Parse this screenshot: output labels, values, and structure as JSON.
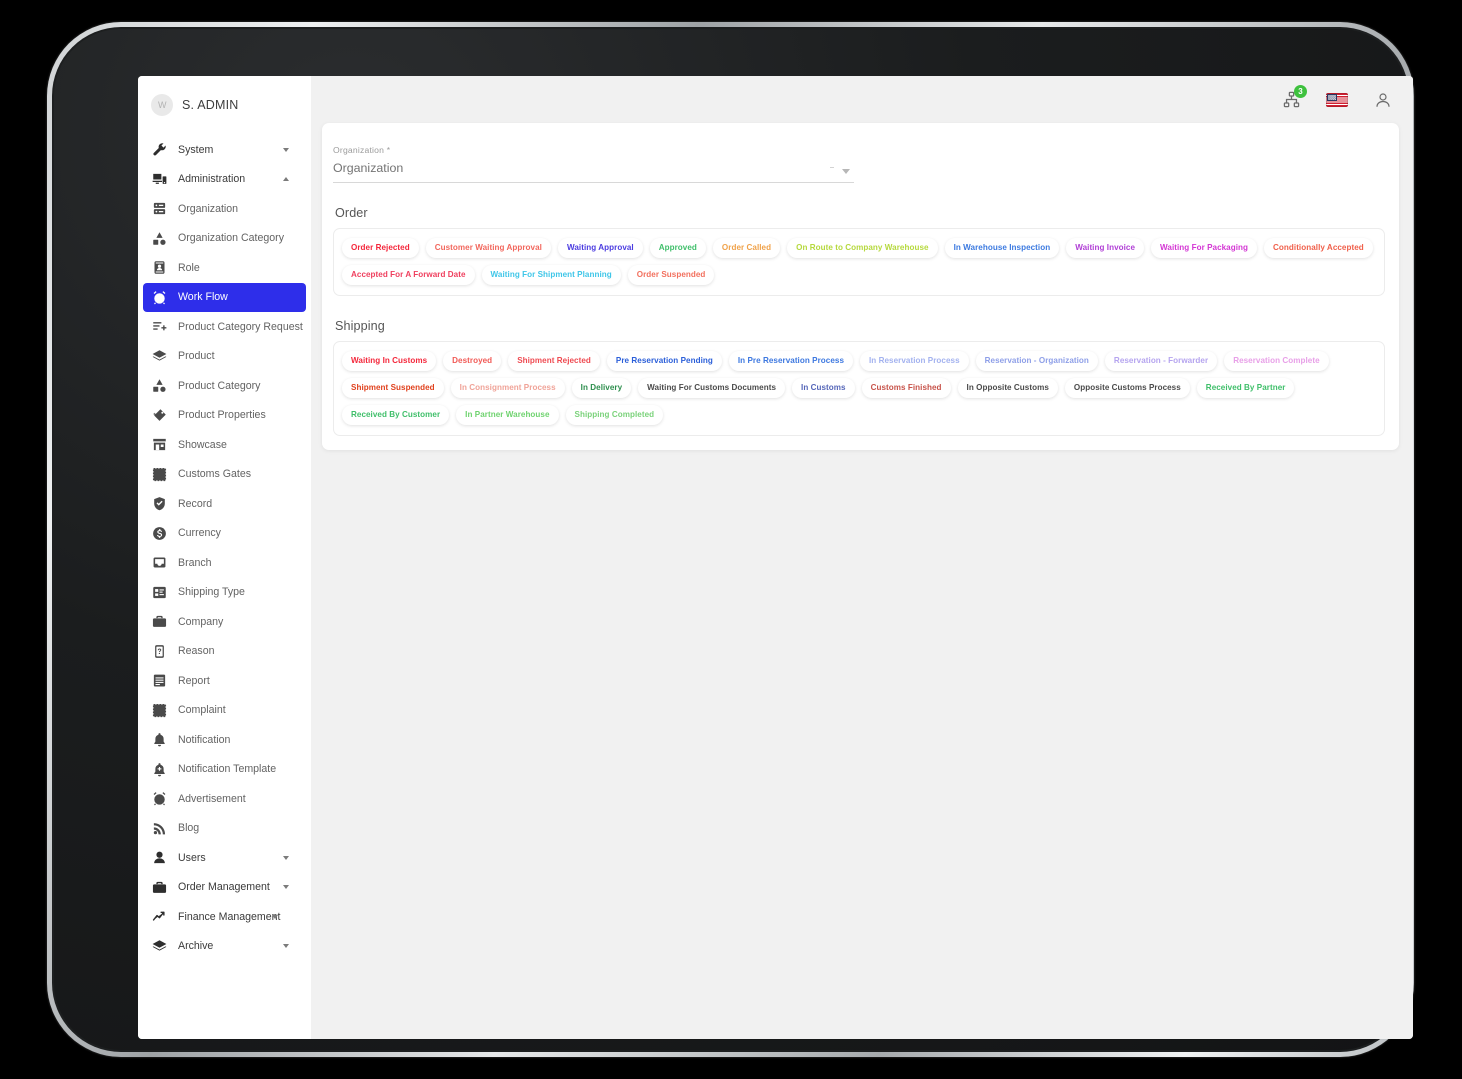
{
  "sidebar": {
    "user": {
      "name": "S. ADMIN",
      "avatar_initials": "W"
    },
    "items": [
      {
        "label": "System",
        "icon": "wrench-icon",
        "type": "group",
        "caret": "down"
      },
      {
        "label": "Administration",
        "icon": "admin-monitor-icon",
        "type": "group",
        "caret": "up"
      },
      {
        "label": "Organization",
        "icon": "server-icon",
        "type": "item"
      },
      {
        "label": "Organization Category",
        "icon": "shapes-icon",
        "type": "item"
      },
      {
        "label": "Role",
        "icon": "id-card-icon",
        "type": "item"
      },
      {
        "label": "Work Flow",
        "icon": "alarm-clock-icon",
        "type": "item",
        "active": true
      },
      {
        "label": "Product Category Request",
        "icon": "list-plus-icon",
        "type": "item"
      },
      {
        "label": "Product",
        "icon": "layers-icon",
        "type": "item"
      },
      {
        "label": "Product Category",
        "icon": "shapes-icon",
        "type": "item"
      },
      {
        "label": "Product Properties",
        "icon": "tags-icon",
        "type": "item"
      },
      {
        "label": "Showcase",
        "icon": "store-icon",
        "type": "item"
      },
      {
        "label": "Customs Gates",
        "icon": "dashed-square-icon",
        "type": "item"
      },
      {
        "label": "Record",
        "icon": "shield-check-icon",
        "type": "item"
      },
      {
        "label": "Currency",
        "icon": "dollar-coin-icon",
        "type": "item"
      },
      {
        "label": "Branch",
        "icon": "inbox-icon",
        "type": "item"
      },
      {
        "label": "Shipping Type",
        "icon": "list-box-icon",
        "type": "item"
      },
      {
        "label": "Company",
        "icon": "briefcase-icon",
        "type": "item"
      },
      {
        "label": "Reason",
        "icon": "question-device-icon",
        "type": "item"
      },
      {
        "label": "Report",
        "icon": "report-icon",
        "type": "item"
      },
      {
        "label": "Complaint",
        "icon": "dashed-square-icon",
        "type": "item"
      },
      {
        "label": "Notification",
        "icon": "bell-icon",
        "type": "item"
      },
      {
        "label": "Notification Template",
        "icon": "bell-plus-icon",
        "type": "item"
      },
      {
        "label": "Advertisement",
        "icon": "alarm-clock-icon",
        "type": "item"
      },
      {
        "label": "Blog",
        "icon": "rss-icon",
        "type": "item"
      },
      {
        "label": "Users",
        "icon": "user-icon",
        "type": "group",
        "caret": "down"
      },
      {
        "label": "Order Management",
        "icon": "briefcase-icon",
        "type": "group",
        "caret": "down"
      },
      {
        "label": "Finance Management",
        "icon": "trend-up-icon",
        "type": "group",
        "caret": "down",
        "caret_tight": true
      },
      {
        "label": "Archive",
        "icon": "layers-icon",
        "type": "group",
        "caret": "down"
      }
    ]
  },
  "topbar": {
    "sitemap_badge": "3",
    "sitemap_icon": "sitemap-icon",
    "flag_icon": "us-flag-icon",
    "account_icon": "user-account-icon"
  },
  "form": {
    "organization": {
      "label": "Organization *",
      "value": "",
      "placeholder": "Organization"
    }
  },
  "sections": [
    {
      "title": "Order",
      "name": "order-section",
      "chips": [
        {
          "label": "Order Rejected",
          "color": "#f4273b"
        },
        {
          "label": "Customer Waiting Approval",
          "color": "#f2675d"
        },
        {
          "label": "Waiting Approval",
          "color": "#4b3ce0"
        },
        {
          "label": "Approved",
          "color": "#3fbf6a"
        },
        {
          "label": "Order Called",
          "color": "#f0a24a"
        },
        {
          "label": "On Route to Company Warehouse",
          "color": "#b6d93e"
        },
        {
          "label": "In Warehouse Inspection",
          "color": "#3c7ae0"
        },
        {
          "label": "Waiting Invoice",
          "color": "#b140d6"
        },
        {
          "label": "Waiting For Packaging",
          "color": "#d437d4"
        },
        {
          "label": "Conditionally Accepted",
          "color": "#f0604b"
        },
        {
          "label": "Accepted For A Forward Date",
          "color": "#ef3f5e"
        },
        {
          "label": "Waiting For Shipment Planning",
          "color": "#3fc6e8"
        },
        {
          "label": "Order Suspended",
          "color": "#f2705e"
        }
      ]
    },
    {
      "title": "Shipping",
      "name": "shipping-section",
      "chips": [
        {
          "label": "Waiting In Customs",
          "color": "#f4273b"
        },
        {
          "label": "Destroyed",
          "color": "#f15a56"
        },
        {
          "label": "Shipment Rejected",
          "color": "#ef4b52"
        },
        {
          "label": "Pre Reservation Pending",
          "color": "#2b5fd9"
        },
        {
          "label": "In Pre Reservation Process",
          "color": "#3d78e0"
        },
        {
          "label": "In Reservation Process",
          "color": "#a3b2ef"
        },
        {
          "label": "Reservation - Organization",
          "color": "#8e9fe8"
        },
        {
          "label": "Reservation - Forwarder",
          "color": "#b5a4ef"
        },
        {
          "label": "Reservation Complete",
          "color": "#e8a0e8"
        },
        {
          "label": "Shipment Suspended",
          "color": "#e0411d"
        },
        {
          "label": "In Consignment Process",
          "color": "#f0a398"
        },
        {
          "label": "In Delivery",
          "color": "#2e8f4e"
        },
        {
          "label": "Waiting For Customs Documents",
          "color": "#4b4b4b"
        },
        {
          "label": "In Customs",
          "color": "#5566b8"
        },
        {
          "label": "Customs Finished",
          "color": "#c7534a"
        },
        {
          "label": "In Opposite Customs",
          "color": "#4b4b4b"
        },
        {
          "label": "Opposite Customs Process",
          "color": "#4b4b4b"
        },
        {
          "label": "Received By Partner",
          "color": "#3fbf6a"
        },
        {
          "label": "Received By Customer",
          "color": "#3fbf6a"
        },
        {
          "label": "In Partner Warehouse",
          "color": "#6fd36f"
        },
        {
          "label": "Shipping Completed",
          "color": "#7ad27a"
        }
      ]
    }
  ]
}
